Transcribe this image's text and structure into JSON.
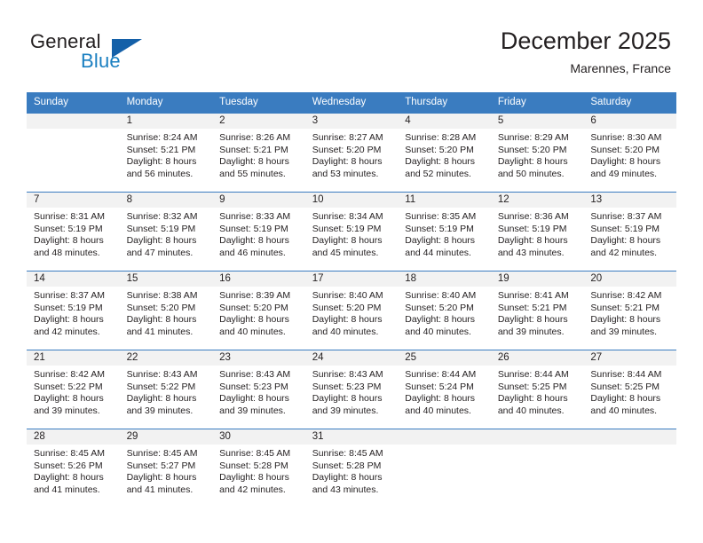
{
  "brand": {
    "word_one": "General",
    "word_two": "Blue",
    "triangle_icon": "triangle-icon",
    "accent_color": "#1460a8",
    "blue_text_color": "#1a7fc1"
  },
  "header": {
    "title": "December 2025",
    "location": "Marennes, France"
  },
  "calendar": {
    "header_bg": "#3a7cc0",
    "daynum_bg": "#f2f2f2",
    "weekday_headers": [
      "Sunday",
      "Monday",
      "Tuesday",
      "Wednesday",
      "Thursday",
      "Friday",
      "Saturday"
    ],
    "weeks": [
      [
        {
          "day": "",
          "sunrise": "",
          "sunset": "",
          "daylight_line1": "",
          "daylight_line2": ""
        },
        {
          "day": "1",
          "sunrise": "Sunrise: 8:24 AM",
          "sunset": "Sunset: 5:21 PM",
          "daylight_line1": "Daylight: 8 hours",
          "daylight_line2": "and 56 minutes."
        },
        {
          "day": "2",
          "sunrise": "Sunrise: 8:26 AM",
          "sunset": "Sunset: 5:21 PM",
          "daylight_line1": "Daylight: 8 hours",
          "daylight_line2": "and 55 minutes."
        },
        {
          "day": "3",
          "sunrise": "Sunrise: 8:27 AM",
          "sunset": "Sunset: 5:20 PM",
          "daylight_line1": "Daylight: 8 hours",
          "daylight_line2": "and 53 minutes."
        },
        {
          "day": "4",
          "sunrise": "Sunrise: 8:28 AM",
          "sunset": "Sunset: 5:20 PM",
          "daylight_line1": "Daylight: 8 hours",
          "daylight_line2": "and 52 minutes."
        },
        {
          "day": "5",
          "sunrise": "Sunrise: 8:29 AM",
          "sunset": "Sunset: 5:20 PM",
          "daylight_line1": "Daylight: 8 hours",
          "daylight_line2": "and 50 minutes."
        },
        {
          "day": "6",
          "sunrise": "Sunrise: 8:30 AM",
          "sunset": "Sunset: 5:20 PM",
          "daylight_line1": "Daylight: 8 hours",
          "daylight_line2": "and 49 minutes."
        }
      ],
      [
        {
          "day": "7",
          "sunrise": "Sunrise: 8:31 AM",
          "sunset": "Sunset: 5:19 PM",
          "daylight_line1": "Daylight: 8 hours",
          "daylight_line2": "and 48 minutes."
        },
        {
          "day": "8",
          "sunrise": "Sunrise: 8:32 AM",
          "sunset": "Sunset: 5:19 PM",
          "daylight_line1": "Daylight: 8 hours",
          "daylight_line2": "and 47 minutes."
        },
        {
          "day": "9",
          "sunrise": "Sunrise: 8:33 AM",
          "sunset": "Sunset: 5:19 PM",
          "daylight_line1": "Daylight: 8 hours",
          "daylight_line2": "and 46 minutes."
        },
        {
          "day": "10",
          "sunrise": "Sunrise: 8:34 AM",
          "sunset": "Sunset: 5:19 PM",
          "daylight_line1": "Daylight: 8 hours",
          "daylight_line2": "and 45 minutes."
        },
        {
          "day": "11",
          "sunrise": "Sunrise: 8:35 AM",
          "sunset": "Sunset: 5:19 PM",
          "daylight_line1": "Daylight: 8 hours",
          "daylight_line2": "and 44 minutes."
        },
        {
          "day": "12",
          "sunrise": "Sunrise: 8:36 AM",
          "sunset": "Sunset: 5:19 PM",
          "daylight_line1": "Daylight: 8 hours",
          "daylight_line2": "and 43 minutes."
        },
        {
          "day": "13",
          "sunrise": "Sunrise: 8:37 AM",
          "sunset": "Sunset: 5:19 PM",
          "daylight_line1": "Daylight: 8 hours",
          "daylight_line2": "and 42 minutes."
        }
      ],
      [
        {
          "day": "14",
          "sunrise": "Sunrise: 8:37 AM",
          "sunset": "Sunset: 5:19 PM",
          "daylight_line1": "Daylight: 8 hours",
          "daylight_line2": "and 42 minutes."
        },
        {
          "day": "15",
          "sunrise": "Sunrise: 8:38 AM",
          "sunset": "Sunset: 5:20 PM",
          "daylight_line1": "Daylight: 8 hours",
          "daylight_line2": "and 41 minutes."
        },
        {
          "day": "16",
          "sunrise": "Sunrise: 8:39 AM",
          "sunset": "Sunset: 5:20 PM",
          "daylight_line1": "Daylight: 8 hours",
          "daylight_line2": "and 40 minutes."
        },
        {
          "day": "17",
          "sunrise": "Sunrise: 8:40 AM",
          "sunset": "Sunset: 5:20 PM",
          "daylight_line1": "Daylight: 8 hours",
          "daylight_line2": "and 40 minutes."
        },
        {
          "day": "18",
          "sunrise": "Sunrise: 8:40 AM",
          "sunset": "Sunset: 5:20 PM",
          "daylight_line1": "Daylight: 8 hours",
          "daylight_line2": "and 40 minutes."
        },
        {
          "day": "19",
          "sunrise": "Sunrise: 8:41 AM",
          "sunset": "Sunset: 5:21 PM",
          "daylight_line1": "Daylight: 8 hours",
          "daylight_line2": "and 39 minutes."
        },
        {
          "day": "20",
          "sunrise": "Sunrise: 8:42 AM",
          "sunset": "Sunset: 5:21 PM",
          "daylight_line1": "Daylight: 8 hours",
          "daylight_line2": "and 39 minutes."
        }
      ],
      [
        {
          "day": "21",
          "sunrise": "Sunrise: 8:42 AM",
          "sunset": "Sunset: 5:22 PM",
          "daylight_line1": "Daylight: 8 hours",
          "daylight_line2": "and 39 minutes."
        },
        {
          "day": "22",
          "sunrise": "Sunrise: 8:43 AM",
          "sunset": "Sunset: 5:22 PM",
          "daylight_line1": "Daylight: 8 hours",
          "daylight_line2": "and 39 minutes."
        },
        {
          "day": "23",
          "sunrise": "Sunrise: 8:43 AM",
          "sunset": "Sunset: 5:23 PM",
          "daylight_line1": "Daylight: 8 hours",
          "daylight_line2": "and 39 minutes."
        },
        {
          "day": "24",
          "sunrise": "Sunrise: 8:43 AM",
          "sunset": "Sunset: 5:23 PM",
          "daylight_line1": "Daylight: 8 hours",
          "daylight_line2": "and 39 minutes."
        },
        {
          "day": "25",
          "sunrise": "Sunrise: 8:44 AM",
          "sunset": "Sunset: 5:24 PM",
          "daylight_line1": "Daylight: 8 hours",
          "daylight_line2": "and 40 minutes."
        },
        {
          "day": "26",
          "sunrise": "Sunrise: 8:44 AM",
          "sunset": "Sunset: 5:25 PM",
          "daylight_line1": "Daylight: 8 hours",
          "daylight_line2": "and 40 minutes."
        },
        {
          "day": "27",
          "sunrise": "Sunrise: 8:44 AM",
          "sunset": "Sunset: 5:25 PM",
          "daylight_line1": "Daylight: 8 hours",
          "daylight_line2": "and 40 minutes."
        }
      ],
      [
        {
          "day": "28",
          "sunrise": "Sunrise: 8:45 AM",
          "sunset": "Sunset: 5:26 PM",
          "daylight_line1": "Daylight: 8 hours",
          "daylight_line2": "and 41 minutes."
        },
        {
          "day": "29",
          "sunrise": "Sunrise: 8:45 AM",
          "sunset": "Sunset: 5:27 PM",
          "daylight_line1": "Daylight: 8 hours",
          "daylight_line2": "and 41 minutes."
        },
        {
          "day": "30",
          "sunrise": "Sunrise: 8:45 AM",
          "sunset": "Sunset: 5:28 PM",
          "daylight_line1": "Daylight: 8 hours",
          "daylight_line2": "and 42 minutes."
        },
        {
          "day": "31",
          "sunrise": "Sunrise: 8:45 AM",
          "sunset": "Sunset: 5:28 PM",
          "daylight_line1": "Daylight: 8 hours",
          "daylight_line2": "and 43 minutes."
        },
        {
          "day": "",
          "sunrise": "",
          "sunset": "",
          "daylight_line1": "",
          "daylight_line2": ""
        },
        {
          "day": "",
          "sunrise": "",
          "sunset": "",
          "daylight_line1": "",
          "daylight_line2": ""
        },
        {
          "day": "",
          "sunrise": "",
          "sunset": "",
          "daylight_line1": "",
          "daylight_line2": ""
        }
      ]
    ]
  }
}
